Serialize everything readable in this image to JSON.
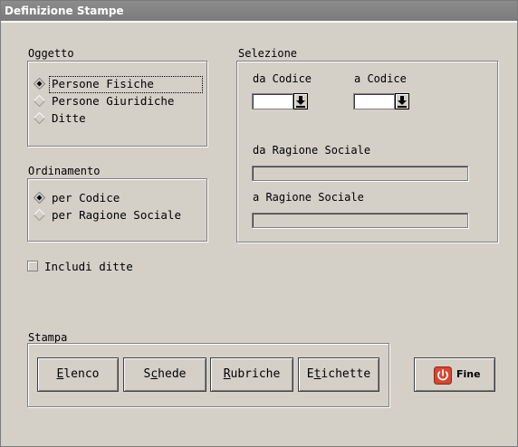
{
  "window": {
    "title": "Definizione Stampe"
  },
  "oggetto": {
    "label": "Oggetto",
    "options": [
      {
        "label": "Persone Fisiche",
        "selected": true
      },
      {
        "label": "Persone Giuridiche",
        "selected": false
      },
      {
        "label": "Ditte",
        "selected": false
      }
    ]
  },
  "ordinamento": {
    "label": "Ordinamento",
    "options": [
      {
        "label": "per Codice",
        "selected": true
      },
      {
        "label": "per Ragione Sociale",
        "selected": false
      }
    ]
  },
  "selezione": {
    "label": "Selezione",
    "da_codice_label": "da Codice",
    "da_codice_value": "",
    "a_codice_label": "a Codice",
    "a_codice_value": "",
    "da_ragione_label": "da Ragione Sociale",
    "da_ragione_value": "",
    "a_ragione_label": "a Ragione Sociale",
    "a_ragione_value": ""
  },
  "includi": {
    "label": "Includi ditte",
    "checked": false
  },
  "stampa": {
    "label": "Stampa",
    "buttons": [
      {
        "label": "Elenco",
        "accel": "E"
      },
      {
        "label": "Schede",
        "accel": "c"
      },
      {
        "label": "Rubriche",
        "accel": "R"
      },
      {
        "label": "Etichette",
        "accel": "t"
      }
    ]
  },
  "fine": {
    "label": "Fine",
    "icon": "power-icon",
    "icon_color": "#d9452f"
  }
}
